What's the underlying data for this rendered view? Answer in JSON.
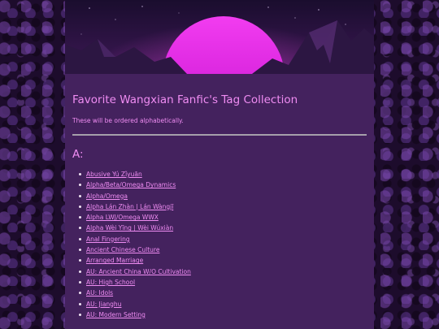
{
  "page": {
    "title": "Favorite Wangxian Fanfic's Tag Collection",
    "intro": "These will be ordered alphabetically.",
    "sections": [
      {
        "letter": "A:",
        "tags": [
          "Abusive Yú Zǐyuān",
          "Alpha/Beta/Omega Dynamics",
          "Alpha/Omega",
          "Alpha Lán Zhàn | Lán Wàngjī",
          "Alpha LWJ/Omega WWX",
          "Alpha Wèi Yīng | Wèi Wúxiàn",
          "Anal Fingering",
          "Ancient Chinese Culture",
          "Arranged Marriage",
          "AU: Ancient China W/O Cultivation",
          "AU: High School",
          "AU: Idols",
          "AU: Jianghu",
          "AU: Modern Setting"
        ]
      }
    ]
  },
  "banner": {
    "icon": "synthwave-sunset-banner",
    "colors": {
      "sky": "#2a1240",
      "sun": "#e21fe8",
      "mountains": "#3a1f52"
    }
  },
  "colors": {
    "accent": "#ef8cf2",
    "panel": "#44225e",
    "divider": "#a6a0ab"
  }
}
